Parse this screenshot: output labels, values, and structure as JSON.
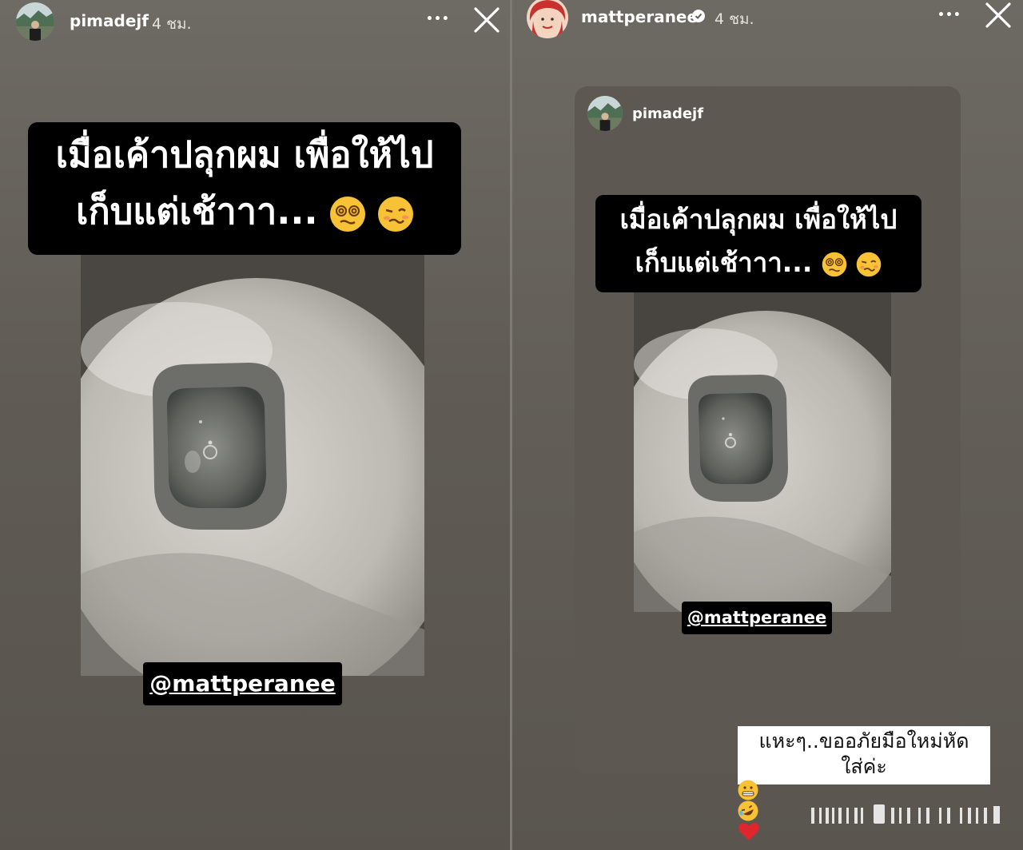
{
  "left_story": {
    "username": "pimadejf",
    "time": "4 ชม.",
    "more_label": "•••",
    "caption_line1": "เมื่อเค้าปลุกผม เพื่อให้ไป",
    "caption_line2": "เก็บแต่เช้าาา...",
    "mention": "@mattperanee"
  },
  "right_story": {
    "username": "mattperanee",
    "time": "4 ชม.",
    "more_label": "•••",
    "reshared_username": "pimadejf",
    "caption_line1": "เมื่อเค้าปลุกผม เพื่อให้ไป",
    "caption_line2": "เก็บแต่เช้าาา...",
    "mention": "@mattperanee",
    "comment_line1": "แหะๆ..ขออภัยมือใหม่หัด",
    "comment_line2": "ใส่ค่ะ",
    "comment_emojis": [
      "grimacing-face",
      "rolling-laughing-face",
      "red-heart"
    ]
  },
  "icons": [
    "more-options-icon",
    "close-icon",
    "verified-badge-icon",
    "dizzy-face-emoji",
    "woozy-face-emoji"
  ],
  "colors": {
    "background": "#635e58",
    "caption_bg": "#000000",
    "text": "#ffffff",
    "heart": "#e0262d",
    "emoji_yellow": "#f7c236"
  }
}
